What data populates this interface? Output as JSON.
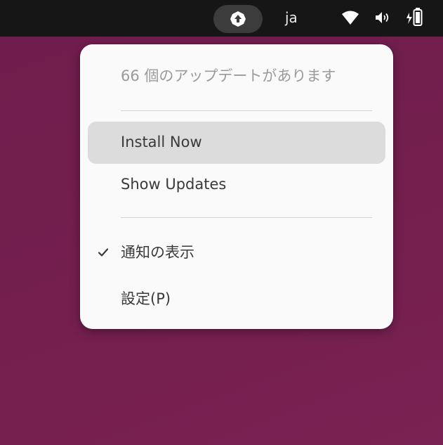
{
  "top_bar": {
    "tray_icon": "software-updater-icon",
    "input_language": "ja",
    "icons": [
      "wifi-icon",
      "volume-icon",
      "battery-charging-icon"
    ]
  },
  "menu": {
    "header": "66 個のアップデートがあります",
    "items": [
      {
        "label": "Install Now",
        "highlighted": true
      },
      {
        "label": "Show Updates",
        "highlighted": false
      },
      {
        "label": "通知の表示",
        "checked": true
      },
      {
        "label": "設定(P)",
        "highlighted": false
      }
    ]
  },
  "colors": {
    "desktop": "#741f4e",
    "panel": "#161616",
    "menu_bg": "#fafafa",
    "highlight": "#dcdcdc"
  }
}
